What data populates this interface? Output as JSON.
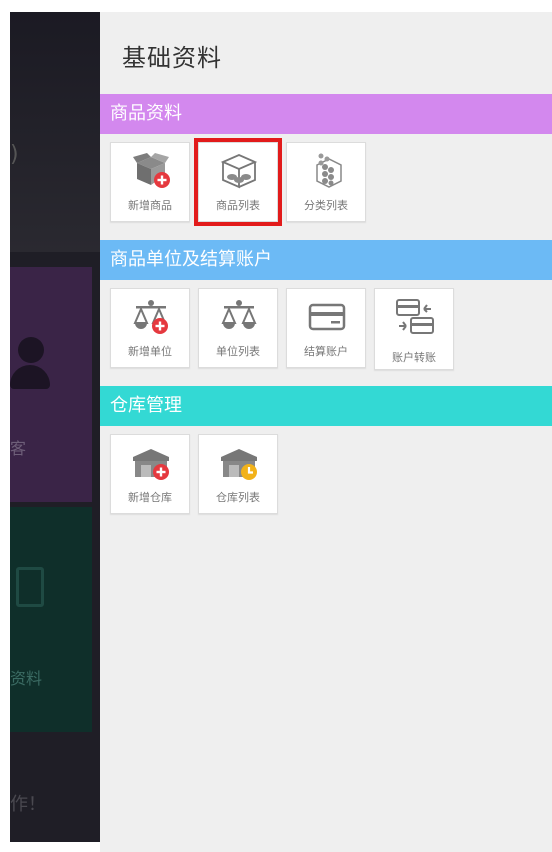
{
  "background": {
    "fragment_top": ")",
    "tile_customer_label": "客",
    "tile_data_label": "资料",
    "bottom_text": "作！"
  },
  "drawer": {
    "title": "基础资料",
    "sections": [
      {
        "title": "商品资料",
        "color": "#d388ee",
        "items": [
          {
            "label": "新增商品",
            "icon": "box-add-icon"
          },
          {
            "label": "商品列表",
            "icon": "box-list-icon",
            "selected": true
          },
          {
            "label": "分类列表",
            "icon": "category-icon"
          }
        ]
      },
      {
        "title": "商品单位及结算账户",
        "color": "#6cbaf5",
        "items": [
          {
            "label": "新增单位",
            "icon": "scale-add-icon"
          },
          {
            "label": "单位列表",
            "icon": "scale-icon"
          },
          {
            "label": "结算账户",
            "icon": "card-icon"
          },
          {
            "label": "账户转账",
            "icon": "transfer-icon"
          }
        ]
      },
      {
        "title": "仓库管理",
        "color": "#33d9d4",
        "items": [
          {
            "label": "新增仓库",
            "icon": "warehouse-add-icon"
          },
          {
            "label": "仓库列表",
            "icon": "warehouse-list-icon"
          }
        ]
      }
    ]
  }
}
